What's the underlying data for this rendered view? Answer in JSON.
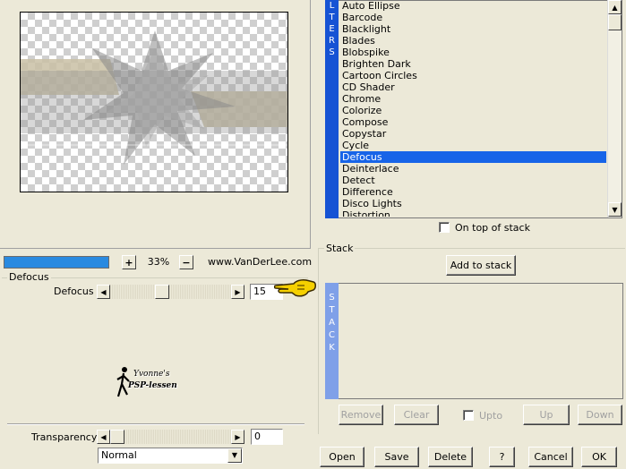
{
  "zoom": {
    "value": "33%",
    "plus": "+",
    "minus": "−",
    "site": "www.VanDerLee.com"
  },
  "defocus_group": {
    "title": "Defocus",
    "slider_label": "Defocus",
    "value": "15"
  },
  "logo": {
    "text_line1": "Yvonne's",
    "text_line2": "PSP-lessen"
  },
  "transparency": {
    "label": "Transparency",
    "value": "0"
  },
  "blend_mode": {
    "value": "Normal"
  },
  "filters": {
    "side_letters": [
      "L",
      "T",
      "E",
      "R",
      "S"
    ],
    "items": [
      "Auto Ellipse",
      "Barcode",
      "Blacklight",
      "Blades",
      "Blobspike",
      "Brighten Dark",
      "Cartoon Circles",
      "CD Shader",
      "Chrome",
      "Colorize",
      "Compose",
      "Copystar",
      "Cycle",
      "Defocus",
      "Deinterlace",
      "Detect",
      "Difference",
      "Disco Lights",
      "Distortion"
    ],
    "selected_index": 13,
    "on_top_label": "On top of stack"
  },
  "stack": {
    "title": "Stack",
    "add_button": "Add to stack",
    "side_letters": [
      "S",
      "T",
      "A",
      "C",
      "K"
    ],
    "remove": "Remove",
    "clear": "Clear",
    "upto": "Upto",
    "up": "Up",
    "down": "Down"
  },
  "footer": {
    "open": "Open",
    "save": "Save",
    "delete": "Delete",
    "help": "?",
    "cancel": "Cancel",
    "ok": "OK"
  },
  "colors": {
    "accent": "#1764e8",
    "filter_side": "#1653d4",
    "stack_side": "#7fa0e8",
    "zoom_bar": "#2a8ae0",
    "pointer": "#f5d000"
  },
  "icons": {
    "pointer": "pointing-hand-icon",
    "logo": "walking-figure-icon"
  }
}
